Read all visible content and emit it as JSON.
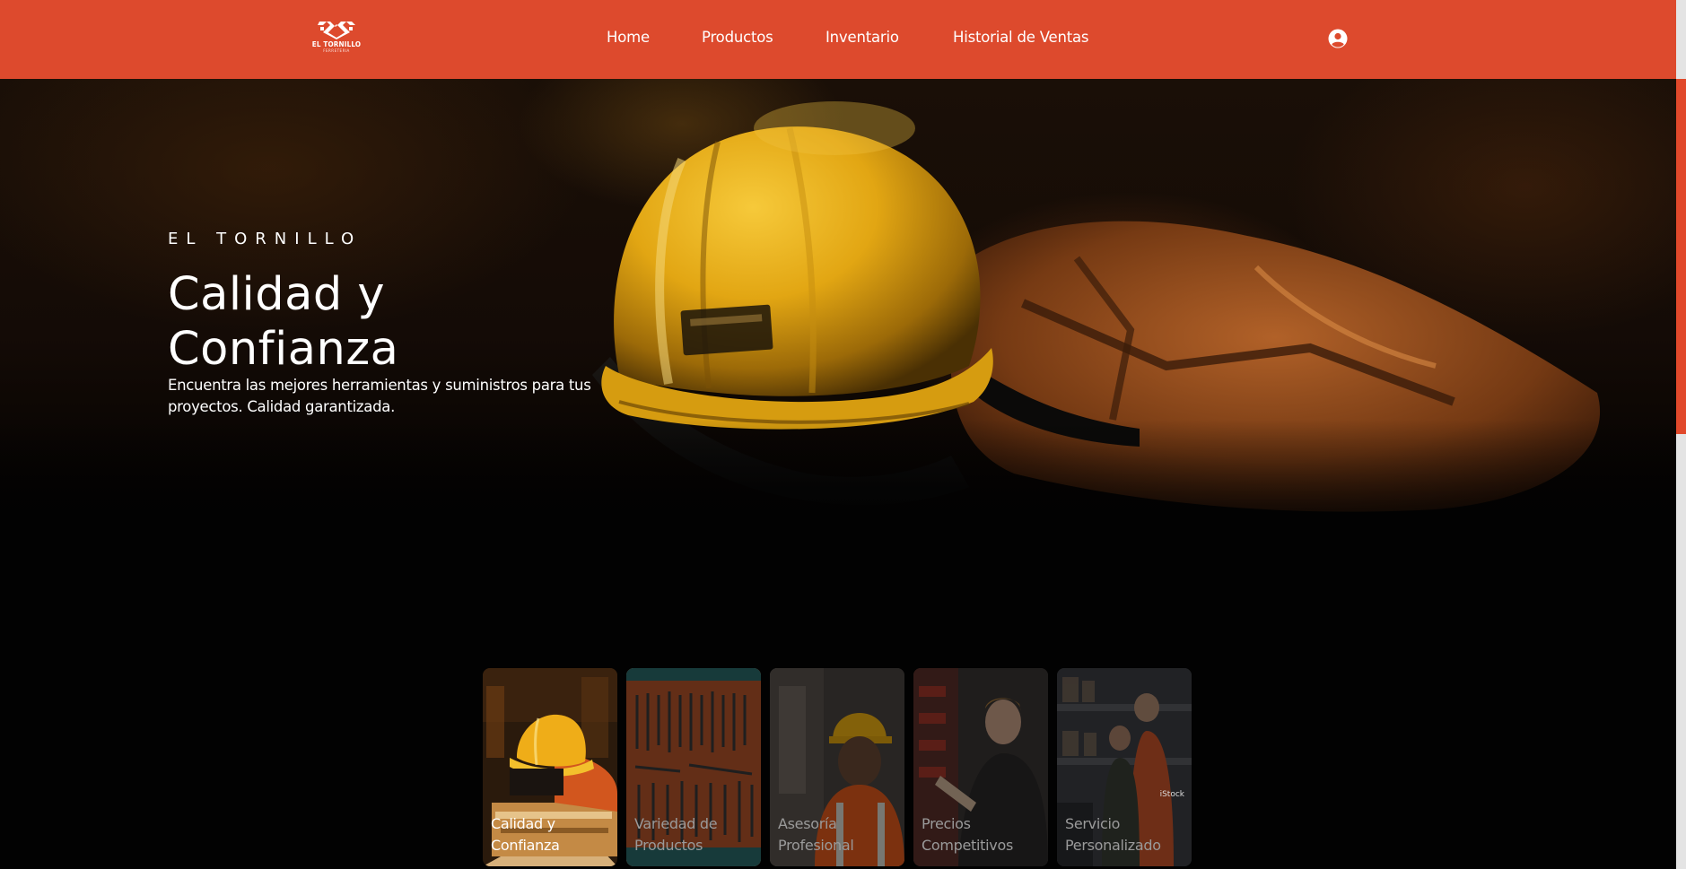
{
  "brand": {
    "logo_name": "EL TORNILLO",
    "logo_sub": "FERRETERIA"
  },
  "nav": {
    "items": [
      {
        "label": "Home"
      },
      {
        "label": "Productos"
      },
      {
        "label": "Inventario"
      },
      {
        "label": "Historial de Ventas"
      }
    ],
    "user_icon": "user-circle-icon"
  },
  "hero": {
    "eyebrow": "EL TORNILLO",
    "title": "Calidad y Confianza",
    "description": "Encuentra las mejores herramientas y suministros para tus proyectos. Calidad garantizada."
  },
  "cards": [
    {
      "label": "Calidad y Confianza",
      "active": true
    },
    {
      "label": "Variedad de Productos",
      "active": false
    },
    {
      "label": "Asesoría Profesional",
      "active": false
    },
    {
      "label": "Precios Competitivos",
      "active": false
    },
    {
      "label": "Servicio Personalizado",
      "active": false,
      "watermark": "iStock"
    }
  ],
  "colors": {
    "navbar": "#dd4a2d",
    "background": "#020202",
    "helmet": "#e8b21a",
    "scroll_thumb": "#e1492b"
  }
}
